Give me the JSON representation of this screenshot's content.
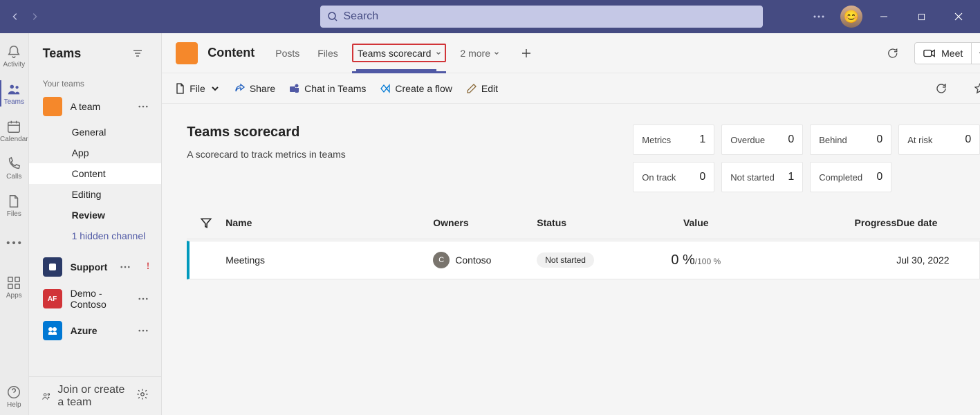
{
  "titlebar": {
    "search_placeholder": "Search"
  },
  "rail": {
    "items": [
      {
        "label": "Activity"
      },
      {
        "label": "Teams"
      },
      {
        "label": "Calendar"
      },
      {
        "label": "Calls"
      },
      {
        "label": "Files"
      }
    ],
    "apps": "Apps",
    "help": "Help"
  },
  "sidebar": {
    "title": "Teams",
    "section": "Your teams",
    "teams": [
      {
        "name": "A team",
        "channels": [
          {
            "name": "General"
          },
          {
            "name": "App"
          },
          {
            "name": "Content"
          },
          {
            "name": "Editing"
          },
          {
            "name": "Review"
          },
          {
            "name": "1 hidden channel"
          }
        ]
      },
      {
        "name": "Support"
      },
      {
        "name": "Demo - Contoso"
      },
      {
        "name": "Azure"
      }
    ],
    "footer": "Join or create a team"
  },
  "channel_header": {
    "title": "Content",
    "tabs": {
      "posts": "Posts",
      "files": "Files",
      "scorecard": "Teams scorecard",
      "more": "2 more"
    },
    "meet": "Meet"
  },
  "cmdbar": {
    "file": "File",
    "share": "Share",
    "chat": "Chat in Teams",
    "flow": "Create a flow",
    "edit": "Edit"
  },
  "scorecard": {
    "title": "Teams scorecard",
    "description": "A scorecard to track metrics in teams",
    "metrics": [
      {
        "label": "Metrics",
        "value": "1"
      },
      {
        "label": "Overdue",
        "value": "0"
      },
      {
        "label": "Behind",
        "value": "0"
      },
      {
        "label": "At risk",
        "value": "0"
      },
      {
        "label": "On track",
        "value": "0"
      },
      {
        "label": "Not started",
        "value": "1"
      },
      {
        "label": "Completed",
        "value": "0"
      }
    ],
    "columns": {
      "name": "Name",
      "owners": "Owners",
      "status": "Status",
      "value": "Value",
      "progress": "Progress",
      "due": "Due date"
    },
    "rows": [
      {
        "name": "Meetings",
        "owner_initial": "C",
        "owner": "Contoso",
        "status": "Not started",
        "value_main": "0 %",
        "value_sub": "/100 %",
        "progress": "",
        "due": "Jul 30, 2022"
      }
    ]
  }
}
